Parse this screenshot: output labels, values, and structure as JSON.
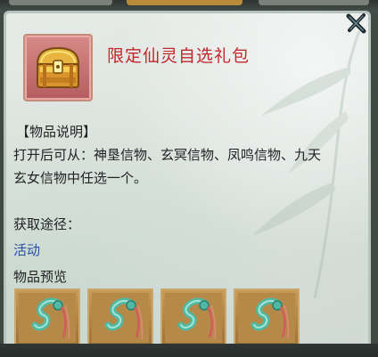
{
  "item": {
    "title": "限定仙灵自选礼包",
    "icon": "treasure-chest-icon"
  },
  "description": {
    "header": "【物品说明】",
    "line1": "打开后可从：神垦信物、玄冥信物、凤鸣信物、九天",
    "line2": "玄女信物中任选一个。"
  },
  "source": {
    "label": "获取途径：",
    "link": "活动"
  },
  "preview": {
    "label": "物品预览",
    "items": [
      {
        "icon": "jade-dragon-token-icon"
      },
      {
        "icon": "jade-dragon-token-icon"
      },
      {
        "icon": "jade-dragon-token-icon"
      },
      {
        "icon": "jade-dragon-token-icon"
      }
    ]
  },
  "colors": {
    "title": "#c1272d",
    "link": "#2a4fa6",
    "panel_bg": "#dfe6e1"
  }
}
